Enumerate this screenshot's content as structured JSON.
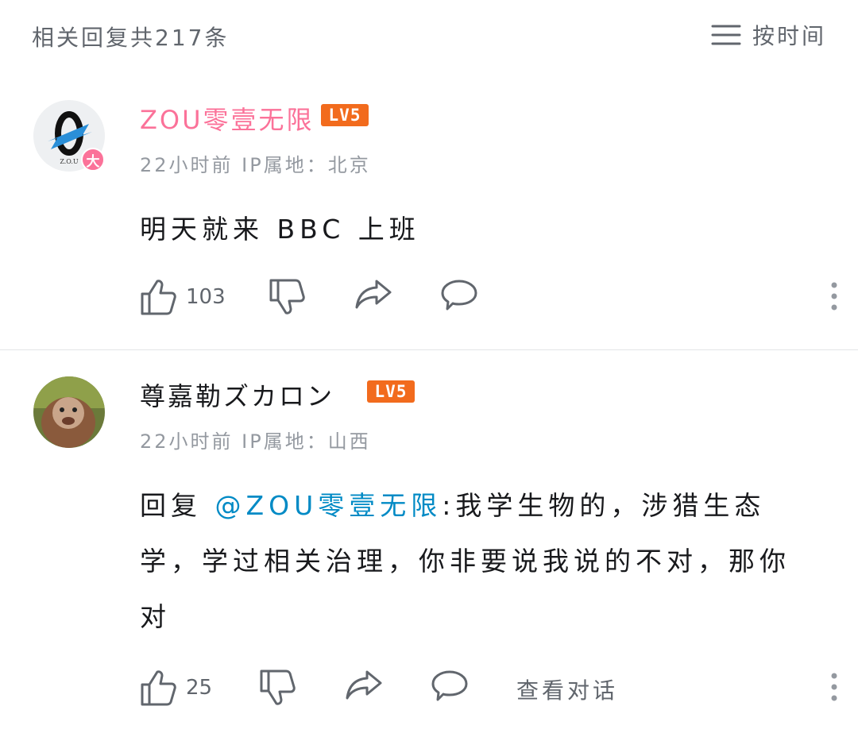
{
  "header": {
    "reply_count": "相关回复共217条",
    "sort_label": "按时间",
    "sort_icon": "menu-lines-icon"
  },
  "comments": [
    {
      "username": "ZOU零壹无限",
      "username_color": "#fb7299",
      "level": "LV5",
      "avatar_badge": "大",
      "avatar_logo_text": "Z.O.U",
      "meta": "22小时前 IP属地：北京",
      "content": "明天就来 BBC 上班",
      "likes": "103"
    },
    {
      "username": "尊嘉勒ズカロン",
      "username_color": "#18191c",
      "level": "LV5",
      "meta": "22小时前 IP属地：山西",
      "reply_prefix": "回复 ",
      "mention": "@ZOU零壹无限",
      "content": ":我学生物的，涉猎生态学，学过相关治理，你非要说我说的不对，那你对",
      "likes": "25",
      "view_conversation": "查看对话"
    }
  ],
  "colors": {
    "accent_pink": "#fb7299",
    "level_orange": "#f26b1d",
    "mention_blue": "#008ac5",
    "meta_gray": "#9499a0"
  }
}
